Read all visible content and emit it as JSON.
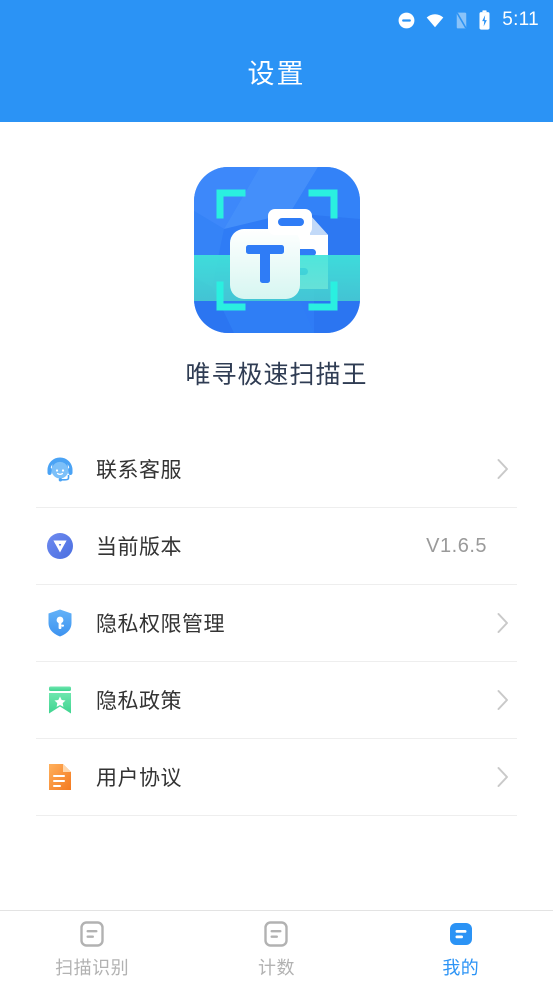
{
  "statusbar": {
    "time": "5:11",
    "icons": [
      "do-not-disturb-icon",
      "wifi-icon",
      "signal-off-icon",
      "battery-charging-icon"
    ]
  },
  "header": {
    "title": "设置",
    "background_color": "#2b93f5"
  },
  "app": {
    "icon_name": "app-logo-scanner-icon",
    "name": "唯寻极速扫描王",
    "icon_colors": {
      "base": "#2f7cf6",
      "accent": "#38e8d8",
      "document": "#ffffff"
    }
  },
  "list": {
    "items": [
      {
        "key": "contact-support",
        "label": "联系客服",
        "icon": "headset-support-icon",
        "icon_color": "#4aa3f5",
        "value": "",
        "has_chevron": true
      },
      {
        "key": "current-version",
        "label": "当前版本",
        "icon": "version-v-icon",
        "icon_color": "#5c78ea",
        "value": "V1.6.5",
        "has_chevron": false
      },
      {
        "key": "privacy-permissions",
        "label": "隐私权限管理",
        "icon": "shield-key-icon",
        "icon_color": "#4aa3f5",
        "value": "",
        "has_chevron": true
      },
      {
        "key": "privacy-policy",
        "label": "隐私政策",
        "icon": "bookmark-star-icon",
        "icon_color": "#4fd89a",
        "value": "",
        "has_chevron": true
      },
      {
        "key": "user-agreement",
        "label": "用户协议",
        "icon": "document-lines-icon",
        "icon_color": "#f68a33",
        "value": "",
        "has_chevron": true
      }
    ]
  },
  "bottomnav": {
    "active_color": "#2b93f5",
    "inactive_color": "#b2b2b2",
    "tabs": [
      {
        "key": "scan",
        "label": "扫描识别",
        "icon": "scan-doc-icon",
        "active": false
      },
      {
        "key": "count",
        "label": "计数",
        "icon": "count-doc-icon",
        "active": false
      },
      {
        "key": "mine",
        "label": "我的",
        "icon": "profile-doc-icon",
        "active": true
      }
    ]
  }
}
